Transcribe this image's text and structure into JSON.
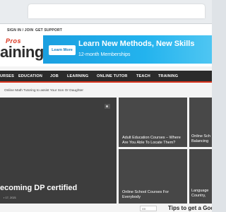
{
  "topbar": {
    "signin_label": "SIGN IN / JOIN",
    "support_label": "GET SUPPORT"
  },
  "header": {
    "logo_top": "Pros",
    "logo_main": "aining",
    "ad": {
      "button_label": "Learn More",
      "headline": "Learn New Methods, New Skills",
      "subline": "12-month Memberships"
    }
  },
  "nav": {
    "items": [
      "URSES",
      "EDUCATION",
      "JOB",
      "LEARNING",
      "ONLINE TUTOR",
      "TEACH",
      "TRAINING"
    ]
  },
  "ticker": {
    "text": "Online Math Tutoring to assist Your Son Or Daughter"
  },
  "tiles": {
    "big_title": "ecoming DP certified",
    "big_date": "r 17, 2021",
    "a_caption": "Adult Education Courses – Where Are You Able To Locate Them?",
    "b_caption": "Online Sch Balancing",
    "c_caption": "Online School Courses For Everybody",
    "d_caption": "Language Country,"
  },
  "bottom": {
    "lang_label": "XX",
    "tips_heading": "Tips to get a Goo"
  },
  "colors": {
    "accent": "#d9331c",
    "nav_bg": "#2b2b2b",
    "ad_bg": "#1a9fe0"
  }
}
